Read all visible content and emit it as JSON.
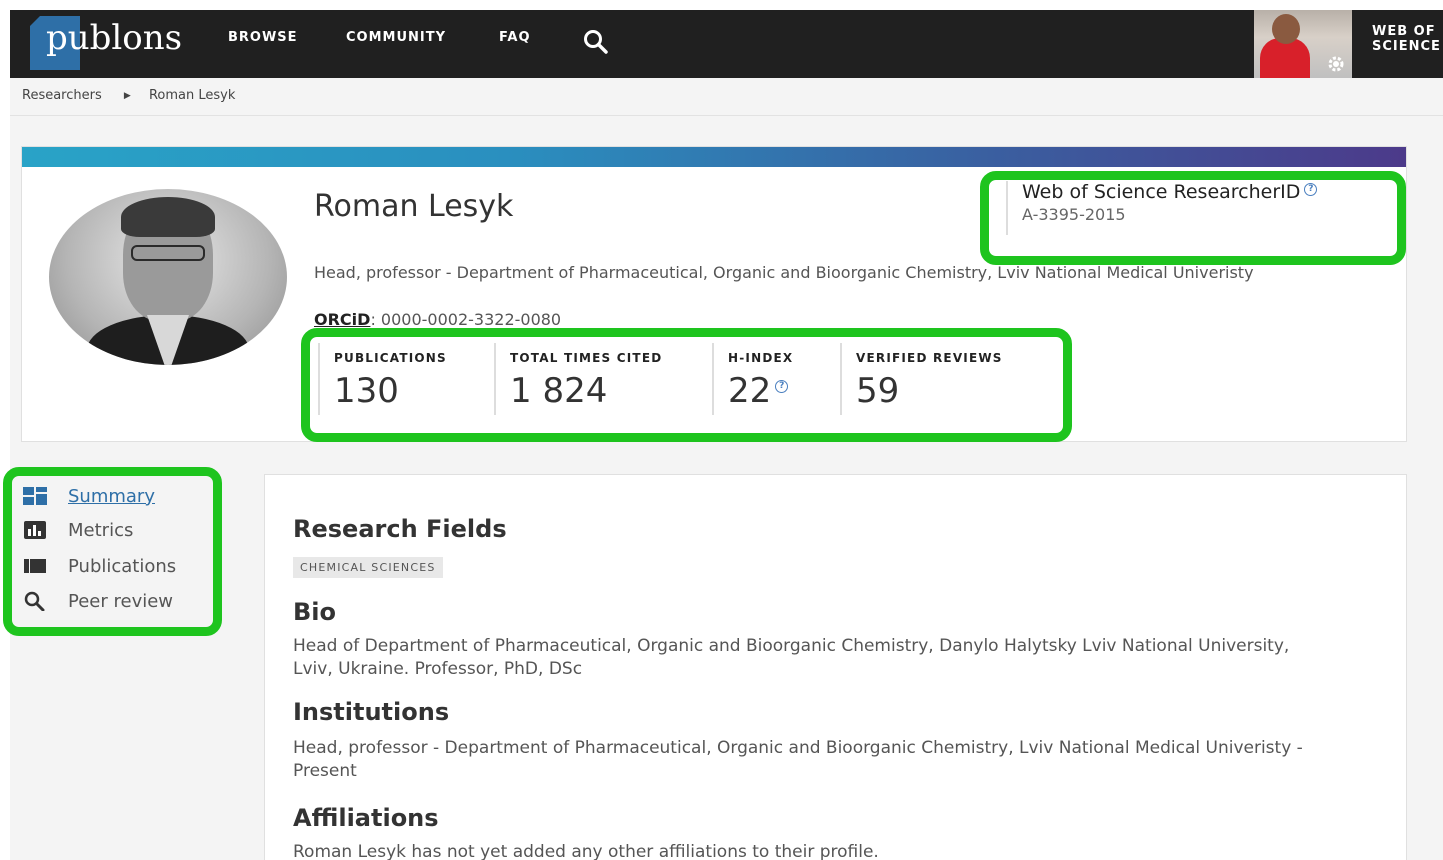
{
  "nav": {
    "logo_text": "publons",
    "items": [
      {
        "label": "BROWSE"
      },
      {
        "label": "COMMUNITY"
      },
      {
        "label": "FAQ"
      }
    ],
    "search_icon": "search-icon",
    "wos_label_line1": "WEB OF",
    "wos_label_line2": "SCIENCE"
  },
  "breadcrumb": {
    "items": [
      "Researchers",
      "Roman Lesyk"
    ]
  },
  "profile": {
    "name": "Roman Lesyk",
    "position": "Head, professor - Department of Pharmaceutical, Organic and Bioorganic Chemistry, Lviv National Medical Univeristy",
    "orcid_label": "ORCiD",
    "orcid_value": ": 0000-0002-3322-0080",
    "researcher_id_title": "Web of Science ResearcherID",
    "researcher_id_value": "A-3395-2015",
    "help_glyph": "?"
  },
  "metrics": [
    {
      "label": "PUBLICATIONS",
      "value": "130"
    },
    {
      "label": "TOTAL TIMES CITED",
      "value": "1 824"
    },
    {
      "label": "H-INDEX",
      "value": "22"
    },
    {
      "label": "VERIFIED REVIEWS",
      "value": "59"
    }
  ],
  "sidebar": {
    "items": [
      {
        "label": "Summary",
        "icon": "dashboard-icon",
        "active": true
      },
      {
        "label": "Metrics",
        "icon": "bar-chart-icon",
        "active": false
      },
      {
        "label": "Publications",
        "icon": "publications-icon",
        "active": false
      },
      {
        "label": "Peer review",
        "icon": "search-icon",
        "active": false
      }
    ]
  },
  "content": {
    "research_fields_title": "Research Fields",
    "research_field_tag": "CHEMICAL SCIENCES",
    "bio_title": "Bio",
    "bio_text": "Head of Department of Pharmaceutical, Organic and Bioorganic Chemistry, Danylo Halytsky Lviv National University, Lviv, Ukraine. Professor, PhD, DSc",
    "institutions_title": "Institutions",
    "institutions_text": "Head, professor - Department of Pharmaceutical, Organic and Bioorganic Chemistry, Lviv National Medical Univeristy - Present",
    "affiliations_title": "Affiliations",
    "affiliations_text": "Roman Lesyk has not yet added any other affiliations to their profile."
  },
  "colors": {
    "highlight": "#1ec41e",
    "nav_bg": "#202020",
    "accent": "#2e6fa7"
  }
}
